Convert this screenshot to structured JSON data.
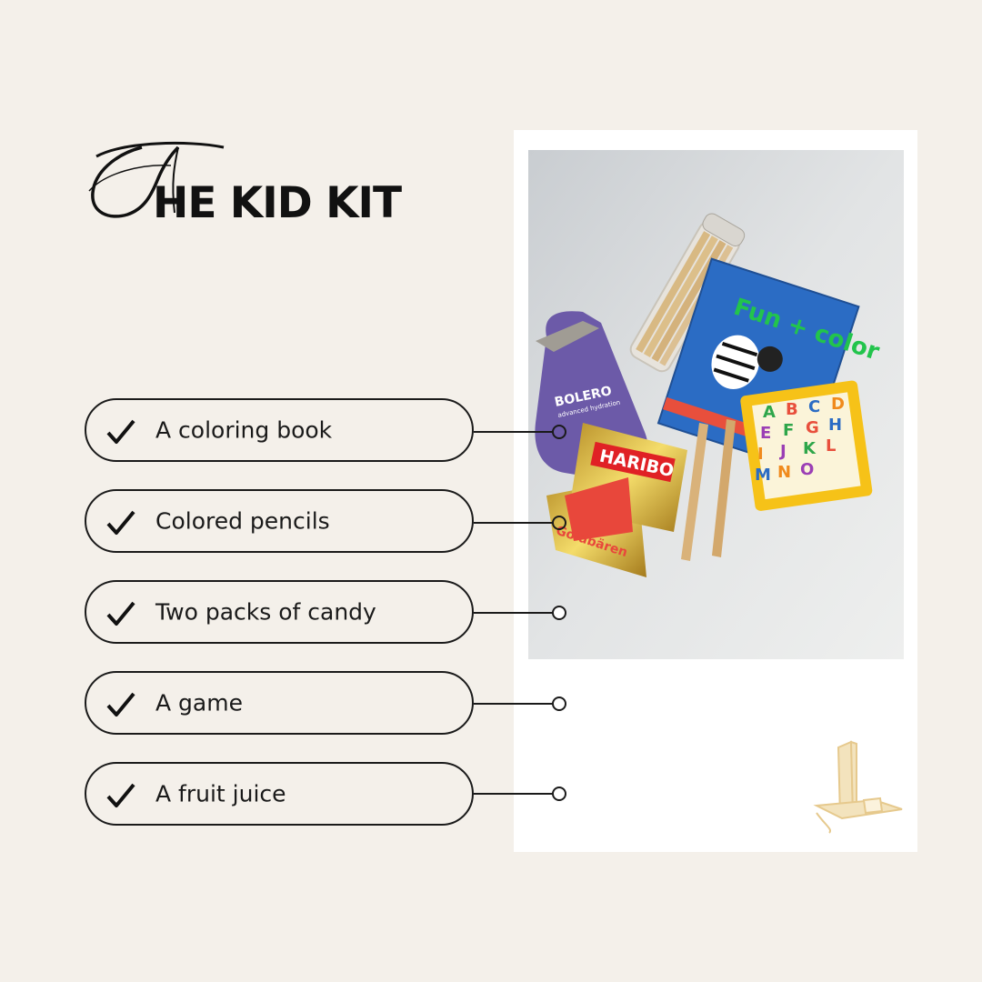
{
  "title": {
    "script_letter": "T",
    "text": "HE KID KIT"
  },
  "checklist": [
    {
      "label": "A coloring book"
    },
    {
      "label": "Colored pencils"
    },
    {
      "label": "Two packs of candy"
    },
    {
      "label": "A game"
    },
    {
      "label": "A fruit juice"
    }
  ],
  "photo": {
    "items": {
      "juice_brand": "BOLERO",
      "juice_sub": "advanced hydration",
      "candy_brand": "HARIBO",
      "candy_name": "Goldbären",
      "book_title": "Fun + color",
      "puzzle_letters": [
        "A",
        "B",
        "C",
        "D",
        "E",
        "F",
        "G",
        "H",
        "I",
        "J",
        "K",
        "L",
        "M",
        "N",
        "O"
      ]
    }
  },
  "colors": {
    "background": "#f4f0ea",
    "ink": "#1a1a1a",
    "card": "#ffffff",
    "logo": "#e9cf99"
  }
}
